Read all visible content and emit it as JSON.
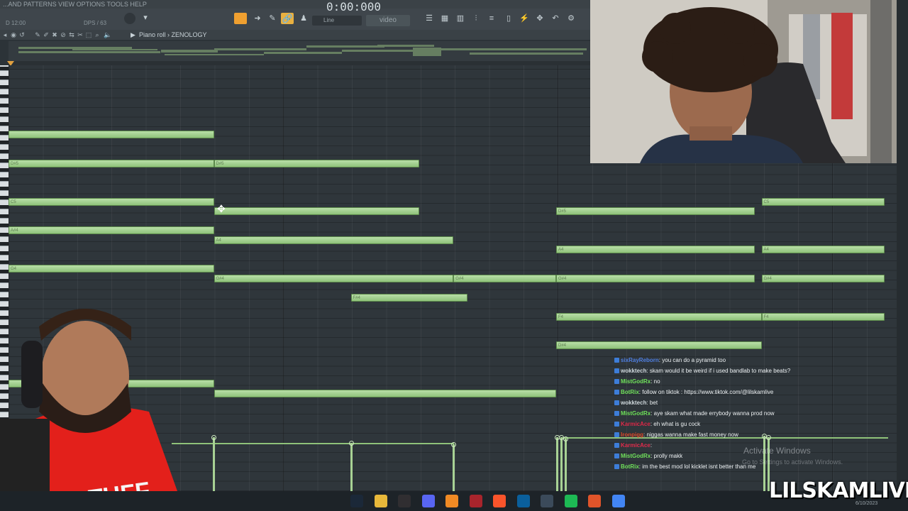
{
  "menubar": {
    "text": "...AND PATTERNS VIEW OPTIONS TOOLS HELP"
  },
  "toolbar": {
    "time": "0:00:000",
    "clock_small": "D 12:00",
    "bpm_small": "DPS / 63",
    "snap_label": "Line",
    "video_label": "video"
  },
  "piano_roll": {
    "title": "Piano roll › ZENOLOGY",
    "arrow": "▶"
  },
  "notes": [
    {
      "label": "",
      "start": 0,
      "length": 3,
      "row": 0
    },
    {
      "label": "D#5",
      "start": 0,
      "length": 3,
      "row": 3
    },
    {
      "label": "D#5",
      "start": 3,
      "length": 3,
      "row": 3
    },
    {
      "label": "C5",
      "start": 0,
      "length": 3,
      "row": 7
    },
    {
      "label": "",
      "start": 3,
      "length": 3,
      "row": 8
    },
    {
      "label": "A#4",
      "start": 0,
      "length": 3,
      "row": 10
    },
    {
      "label": "A4",
      "start": 3,
      "length": 3.5,
      "row": 11
    },
    {
      "label": "G4",
      "start": 0,
      "length": 3,
      "row": 14
    },
    {
      "label": "G#4",
      "start": 3,
      "length": 3.5,
      "row": 15
    },
    {
      "label": "G#4",
      "start": 6.5,
      "length": 1.5,
      "row": 15
    },
    {
      "label": "F#4",
      "start": 5,
      "length": 1.7,
      "row": 17
    },
    {
      "label": "D#5",
      "start": 8,
      "length": 2.9,
      "row": 8
    },
    {
      "label": "C5",
      "start": 11,
      "length": 1.8,
      "row": 7
    },
    {
      "label": "A4",
      "start": 8,
      "length": 2.9,
      "row": 12
    },
    {
      "label": "A4",
      "start": 11,
      "length": 1.8,
      "row": 12
    },
    {
      "label": "G#4",
      "start": 8,
      "length": 2.9,
      "row": 15
    },
    {
      "label": "G#4",
      "start": 11,
      "length": 1.8,
      "row": 15
    },
    {
      "label": "F4",
      "start": 8,
      "length": 3,
      "row": 19
    },
    {
      "label": "F4",
      "start": 11,
      "length": 1.8,
      "row": 19
    },
    {
      "label": "D#4",
      "start": 8,
      "length": 3,
      "row": 22
    },
    {
      "label": "",
      "start": 0,
      "length": 3,
      "row": 26
    },
    {
      "label": "",
      "start": 3,
      "length": 5,
      "row": 27
    }
  ],
  "chat": [
    {
      "user": "sixRayReborn",
      "message": ": you can do a pyramid too",
      "color": "#4f7fe0"
    },
    {
      "user": "wokktech",
      "message": ": skam would it be weird if i used bandlab to make beats?",
      "color": "#cfd8dc"
    },
    {
      "user": "MistGodRx",
      "message": ": no",
      "color": "#6fe05a"
    },
    {
      "user": "BotRix",
      "message": ": follow on tiktok : https://www.tiktok.com/@lilskamlive",
      "color": "#6fe05a"
    },
    {
      "user": "wokktech",
      "message": ": bet",
      "color": "#cfd8dc"
    },
    {
      "user": "MistGodRx",
      "message": ": aye skam what made errybody wanna prod now",
      "color": "#6fe05a"
    },
    {
      "user": "KarmicAce",
      "message": ": eh what is gu cock",
      "color": "#e02a4a"
    },
    {
      "user": "Ironpigg",
      "message": ": niggas wanna make fast money now",
      "color": "#e04a2a"
    },
    {
      "user": "KarmicAce",
      "message": ":",
      "color": "#e02a4a"
    },
    {
      "user": "MistGodRx",
      "message": ": prolly makk",
      "color": "#6fe05a"
    },
    {
      "user": "BotRix",
      "message": ": im the best mod lol kicklet isnt better than me",
      "color": "#6fe05a"
    }
  ],
  "watermark": {
    "title": "Activate Windows",
    "subtitle": "Go to Settings to activate Windows."
  },
  "stream_logo": "LILSKAMLIVE",
  "taskbar": {
    "date": "6/10/2023",
    "apps": [
      {
        "icon": "steam-icon",
        "color": "#1b2838"
      },
      {
        "icon": "folder-icon",
        "color": "#e8b83a"
      },
      {
        "icon": "obs-icon",
        "color": "#302e31"
      },
      {
        "icon": "discord-icon",
        "color": "#5865f2"
      },
      {
        "icon": "fl-studio-icon",
        "color": "#f08a24"
      },
      {
        "icon": "app-red-icon",
        "color": "#a8242c"
      },
      {
        "icon": "brave-icon",
        "color": "#fb542b"
      },
      {
        "icon": "vscode-icon",
        "color": "#0a5f9c"
      },
      {
        "icon": "calculator-icon",
        "color": "#3b4a5a"
      },
      {
        "icon": "spotify-icon",
        "color": "#1db954"
      },
      {
        "icon": "orange-app-icon",
        "color": "#e0542a"
      },
      {
        "icon": "chrome-icon",
        "color": "#4285f4"
      }
    ]
  },
  "colors": {
    "note": "#a8d294",
    "grid": "#2f363b",
    "accent": "#f0a030"
  }
}
